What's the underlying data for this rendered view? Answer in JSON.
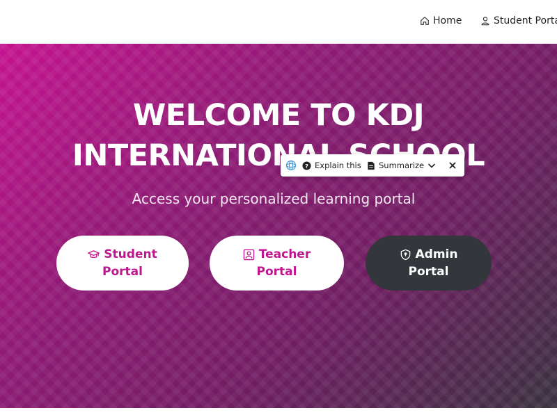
{
  "nav": {
    "home_icon": "home-icon",
    "home_label": "Home",
    "student_icon": "user-icon",
    "student_label": "Student Portal"
  },
  "hero": {
    "title_line1": "WELCOME TO KDJ",
    "title_line2": "INTERNATIONAL SCHOOL",
    "subtitle": "Access your personalized learning portal"
  },
  "portals": [
    {
      "icon": "graduation-cap-icon",
      "line1": "Student",
      "line2": "Portal"
    },
    {
      "icon": "teacher-board-icon",
      "line1": "Teacher",
      "line2": "Portal"
    },
    {
      "icon": "shield-icon",
      "line1": "Admin",
      "line2": "Portal"
    }
  ],
  "ai_toolbar": {
    "logo_icon": "ai-assistant-icon",
    "explain_label": "Explain this",
    "summarize_label": "Summarize"
  },
  "colors": {
    "accent": "#c0158f",
    "admin_button": "#33363b",
    "hero_start": "#c4138f",
    "hero_end": "#3a3140"
  }
}
